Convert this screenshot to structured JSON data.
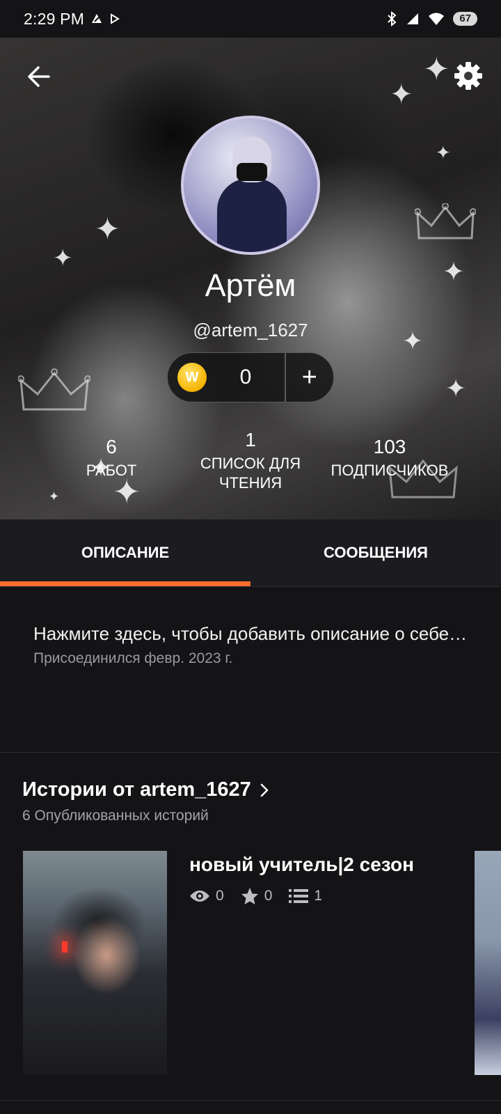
{
  "status_bar": {
    "time": "2:29 PM",
    "battery": "67"
  },
  "profile": {
    "display_name": "Артём",
    "username": "@artem_1627",
    "coins": "0",
    "coin_symbol": "W",
    "add_symbol": "+",
    "stats": [
      {
        "value": "6",
        "label": "РАБОТ"
      },
      {
        "value": "1",
        "label": "СПИСОК ДЛЯ ЧТЕНИЯ"
      },
      {
        "value": "103",
        "label": "ПОДПИСЧИКОВ"
      }
    ]
  },
  "tabs": [
    {
      "label": "ОПИСАНИЕ",
      "active": true
    },
    {
      "label": "СООБЩЕНИЯ",
      "active": false
    }
  ],
  "about": {
    "placeholder_text": "Нажмите здесь, чтобы добавить описание о себе…",
    "joined": "Присоединился февр. 2023 г."
  },
  "stories": {
    "title": "Истории от artem_1627",
    "subtitle": "6 Опубликованных историй",
    "items": [
      {
        "title": "новый учитель|2 сезон",
        "views": "0",
        "votes": "0",
        "parts": "1"
      }
    ]
  },
  "colors": {
    "accent": "#ff6b2c",
    "background": "#141316",
    "tab_bar": "#1c1b1f",
    "coin": "#f6b300"
  },
  "icons": [
    "back-arrow-icon",
    "gear-icon",
    "coin-icon",
    "plus-icon",
    "chevron-right-icon",
    "eye-icon",
    "star-icon",
    "list-icon",
    "bluetooth-icon",
    "signal-icon",
    "wifi-icon"
  ]
}
